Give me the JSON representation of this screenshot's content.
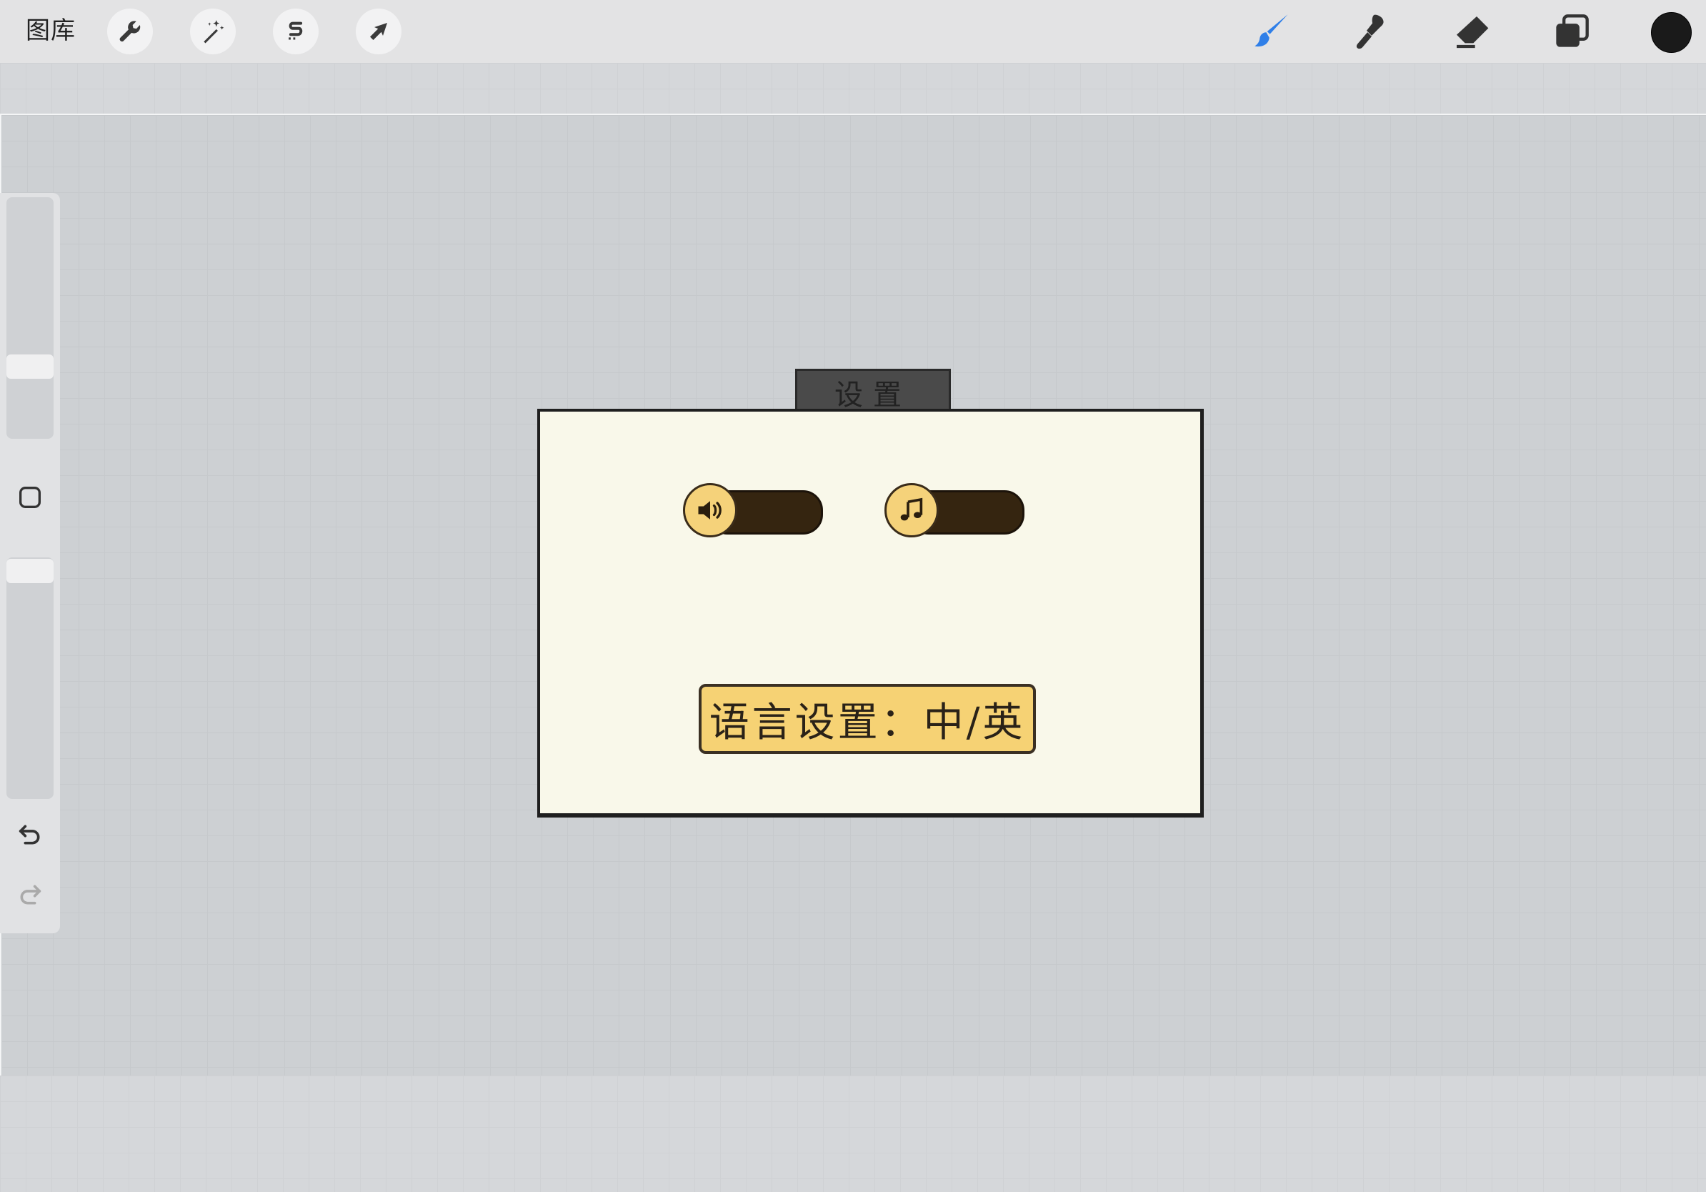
{
  "app": {
    "gallery_label": "图库",
    "toolbar_left": [
      "wrench-icon",
      "magic-wand-icon",
      "selection-s-icon",
      "arrow-cursor-icon"
    ],
    "toolbar_right": [
      "brush-icon",
      "smudge-icon",
      "eraser-icon",
      "layers-icon",
      "color-swatch"
    ],
    "active_tool": "brush-icon",
    "accent_color": "#2f7fe8",
    "current_color": "#1a1a1a"
  },
  "sidebar": {
    "brush_size_level": 0.7,
    "opacity_level": 0.05,
    "items": [
      "size-slider",
      "modify-square",
      "opacity-slider",
      "undo-icon",
      "redo-icon"
    ]
  },
  "canvas": {
    "tab_title": "设置",
    "toggles": [
      {
        "icon": "speaker-icon"
      },
      {
        "icon": "music-note-icon"
      }
    ],
    "language_button": "语言设置：中/英",
    "panel_color": "#f9f8ea",
    "button_color": "#f6d274",
    "toggle_color": "#352510"
  }
}
